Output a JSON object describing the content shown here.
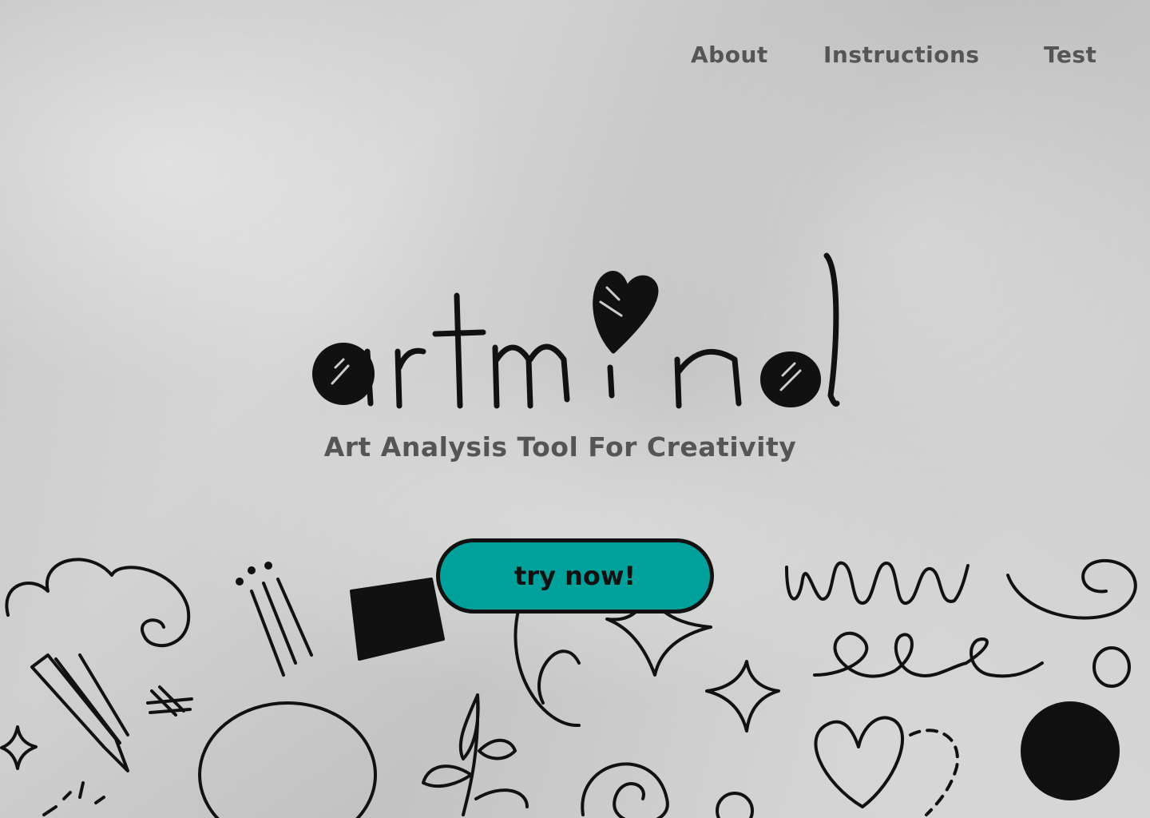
{
  "nav": {
    "about": "About",
    "instructions": "Instructions",
    "test": "Test"
  },
  "hero": {
    "logo_text": "artmind",
    "tagline": "Art Analysis Tool For Creativity",
    "cta_label": "try now!"
  },
  "colors": {
    "cta_background": "#00a19a",
    "text_gray": "#555555",
    "ink": "#111111"
  }
}
